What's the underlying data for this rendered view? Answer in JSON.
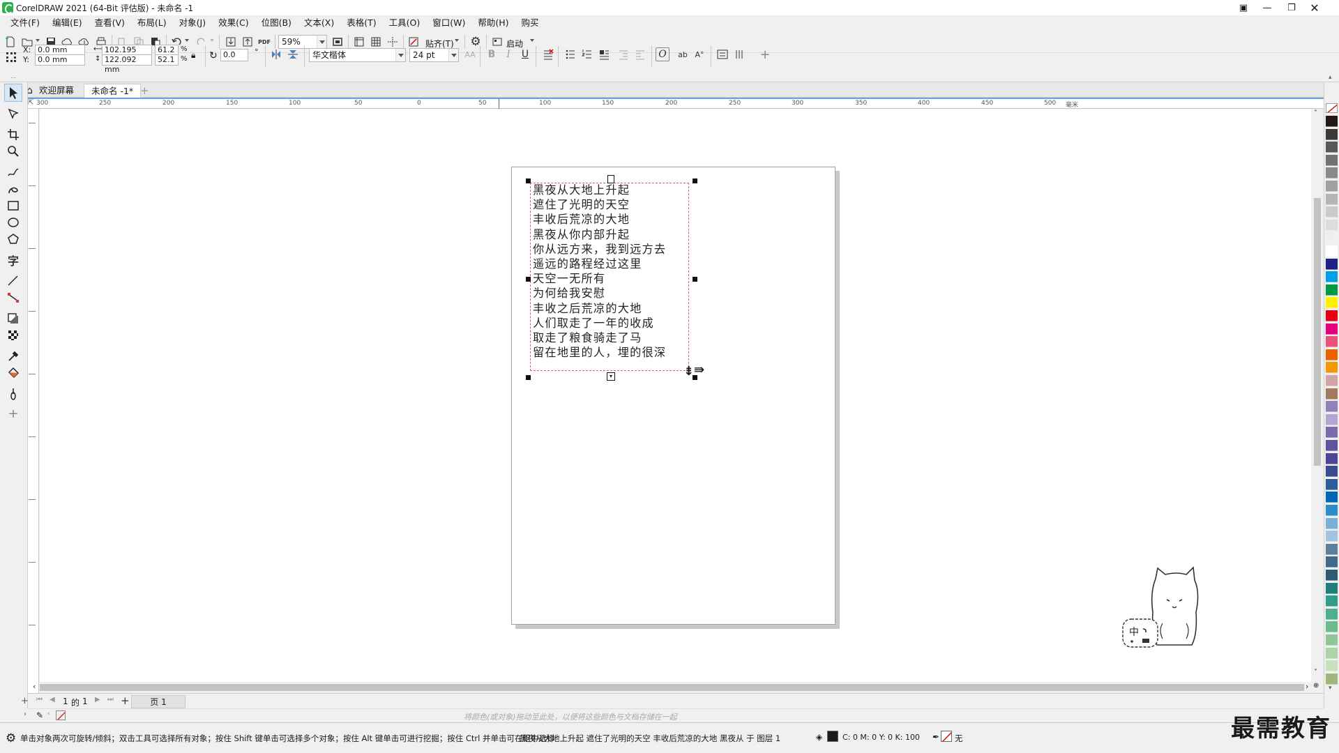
{
  "window": {
    "title": "CorelDRAW 2021 (64-Bit 评估版) - 未命名 -1"
  },
  "menu": [
    "文件(F)",
    "编辑(E)",
    "查看(V)",
    "布局(L)",
    "对象(J)",
    "效果(C)",
    "位图(B)",
    "文本(X)",
    "表格(T)",
    "工具(O)",
    "窗口(W)",
    "帮助(H)",
    "购买"
  ],
  "toolbar": {
    "zoom": "59%",
    "snap_label": "贴齐(T)",
    "launch_label": "启动"
  },
  "props": {
    "x_label": "X:",
    "y_label": "Y:",
    "x": "0.0 mm",
    "y": "0.0 mm",
    "width": "102.195 mm",
    "height": "122.092 mm",
    "scale_x": "61.2",
    "scale_y": "52.1",
    "pct": "%",
    "rotation": "0.0",
    "rot_unit": "°",
    "font": "华文楷体",
    "size": "24 pt"
  },
  "tabs": {
    "welcome": "欢迎屏幕",
    "doc": "未命名 -1*"
  },
  "ruler": {
    "h": [
      "300",
      "250",
      "200",
      "150",
      "100",
      "50",
      "0",
      "50",
      "100",
      "150",
      "200",
      "250",
      "300",
      "350",
      "400",
      "450",
      "500"
    ],
    "unit": "毫米"
  },
  "poem": [
    "黑夜从大地上升起",
    "遮住了光明的天空",
    "丰收后荒凉的大地",
    "黑夜从你内部升起",
    "你从远方来，我到远方去",
    "遥远的路程经过这里",
    "天空一无所有",
    "为何给我安慰",
    "丰收之后荒凉的大地",
    "人们取走了一年的收成",
    "取走了粮食骑走了马",
    "留在地里的人，埋的很深"
  ],
  "pagenav": {
    "current": "1",
    "of": "的",
    "total": "1",
    "page_tab": "页 1"
  },
  "docpal": {
    "hint": "将颜色(或对象)拖动至此处，以便将这些颜色与文档存储在一起"
  },
  "status": {
    "hint": "单击对象两次可旋转/倾斜；双击工具可选择所有对象；按住 Shift 键单击可选择多个对象；按住 Alt 键单击可进行挖掘；按住 Ctrl 并单击可在组中选择",
    "object": "黑夜从大地上升起 遮住了光明的天空 丰收后荒凉的大地 黑夜从 于 图层 1",
    "cmyk": "C: 0 M: 0 Y: 0 K: 100",
    "outline": "无"
  },
  "cat": {
    "badge": "中"
  },
  "watermark": "最需教育",
  "palette": [
    "#231815",
    "#3e3a39",
    "#595757",
    "#727171",
    "#898989",
    "#9fa0a0",
    "#b5b5b6",
    "#c9caca",
    "#dcdddd",
    "#efefef",
    "#ffffff",
    "#1d2088",
    "#00a0e9",
    "#009944",
    "#fff100",
    "#e60012",
    "#e4007f",
    "#e95377",
    "#eb6100",
    "#f39800",
    "#d3a4a5",
    "#a07a5e",
    "#8f82bc",
    "#b3a6d1",
    "#7d6aae",
    "#5f52a0",
    "#4c4596",
    "#3a4a8c",
    "#2b5d9e",
    "#0068b7",
    "#2e8bc9",
    "#7ab0d6",
    "#a3c3df",
    "#5e7f99",
    "#3f6a8a",
    "#2d5c74",
    "#1e7f7a",
    "#2f9d8a",
    "#4fae8f",
    "#6fba8d",
    "#8ec69a",
    "#acd4a8",
    "#c8e2c0",
    "#9db87a"
  ]
}
